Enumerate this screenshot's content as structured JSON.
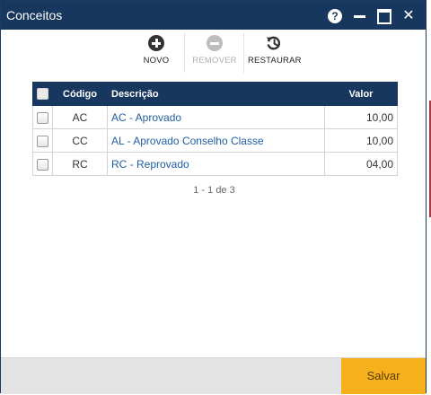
{
  "window": {
    "title": "Conceitos"
  },
  "toolbar": {
    "novo_label": "NOVO",
    "remover_label": "REMOVER",
    "restaurar_label": "RESTAURAR"
  },
  "table": {
    "headers": {
      "codigo": "Código",
      "descricao": "Descrição",
      "valor": "Valor"
    },
    "rows": [
      {
        "codigo": "AC",
        "descricao": "AC - Aprovado",
        "valor": "10,00"
      },
      {
        "codigo": "CC",
        "descricao": "AL - Aprovado Conselho Classe",
        "valor": "10,00"
      },
      {
        "codigo": "RC",
        "descricao": "RC - Reprovado",
        "valor": "04,00"
      }
    ]
  },
  "pager": {
    "text": "1 - 1 de 3"
  },
  "footer": {
    "save_label": "Salvar"
  },
  "colors": {
    "header_bg": "#17375e",
    "link": "#1f5fa3",
    "save_bg": "#f5b01c"
  }
}
